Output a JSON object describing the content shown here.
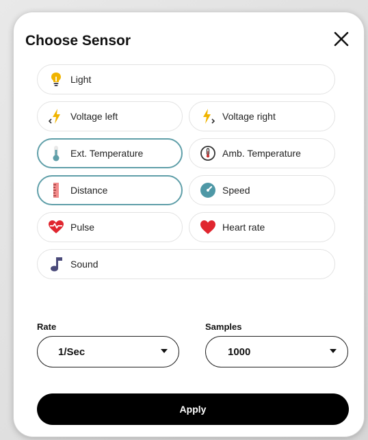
{
  "dialog": {
    "title": "Choose Sensor"
  },
  "sensors": [
    {
      "label": "Light",
      "icon": "lightbulb-icon",
      "selected": false
    },
    {
      "label": "Voltage left",
      "icon": "lightning-left-icon",
      "selected": false
    },
    {
      "label": "Voltage right",
      "icon": "lightning-right-icon",
      "selected": false
    },
    {
      "label": "Ext. Temperature",
      "icon": "thermometer-icon",
      "selected": true
    },
    {
      "label": "Amb. Temperature",
      "icon": "thermometer-circle-icon",
      "selected": false
    },
    {
      "label": "Distance",
      "icon": "ruler-icon",
      "selected": true
    },
    {
      "label": "Speed",
      "icon": "speedometer-icon",
      "selected": false
    },
    {
      "label": "Pulse",
      "icon": "pulse-heart-icon",
      "selected": false
    },
    {
      "label": "Heart rate",
      "icon": "heart-icon",
      "selected": false
    },
    {
      "label": "Sound",
      "icon": "music-note-icon",
      "selected": false
    }
  ],
  "rate": {
    "label": "Rate",
    "value": "1/Sec"
  },
  "samples": {
    "label": "Samples",
    "value": "1000"
  },
  "apply_label": "Apply",
  "colors": {
    "selected_border": "#5e9ea8",
    "bulb": "#f0b400",
    "bolt": "#f0b400",
    "thermo": "#5e9ea8",
    "ruler": "#f28b8b",
    "speed": "#4e98a6",
    "heart": "#e0262f",
    "note": "#4a4a7a"
  }
}
